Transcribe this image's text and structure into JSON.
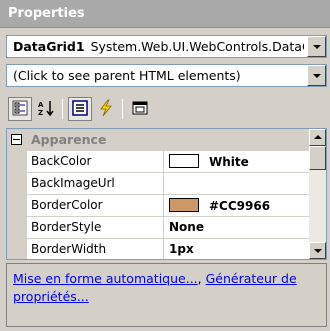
{
  "window": {
    "title": "Properties"
  },
  "object_selector": {
    "object_name": "DataGrid1",
    "object_type": "System.Web.UI.WebControls.DataGrid"
  },
  "parent_selector": {
    "text": "(Click to see parent HTML elements)"
  },
  "toolbar": {
    "buttons": [
      {
        "icon": "categorized-icon",
        "pressed": true
      },
      {
        "icon": "alphabetical-icon",
        "pressed": false
      },
      {
        "icon": "properties-icon",
        "pressed": true
      },
      {
        "icon": "events-icon",
        "pressed": false
      },
      {
        "icon": "property-pages-icon",
        "pressed": false
      }
    ]
  },
  "grid": {
    "category": "Apparence",
    "properties": [
      {
        "name": "BackColor",
        "value": "White",
        "swatch": "#FFFFFF"
      },
      {
        "name": "BackImageUrl",
        "value": ""
      },
      {
        "name": "BorderColor",
        "value": "#CC9966",
        "swatch": "#CC9966"
      },
      {
        "name": "BorderStyle",
        "value": "None"
      },
      {
        "name": "BorderWidth",
        "value": "1px"
      }
    ]
  },
  "commands": {
    "link1": "Mise en forme automatique...",
    "separator": ", ",
    "link2": "Générateur de propriétés..."
  },
  "colors": {
    "title_bar": "#A9A9A9",
    "panel_bg": "#D4D0C8",
    "link": "#0000EE",
    "border_color_swatch": "#CC9966"
  }
}
